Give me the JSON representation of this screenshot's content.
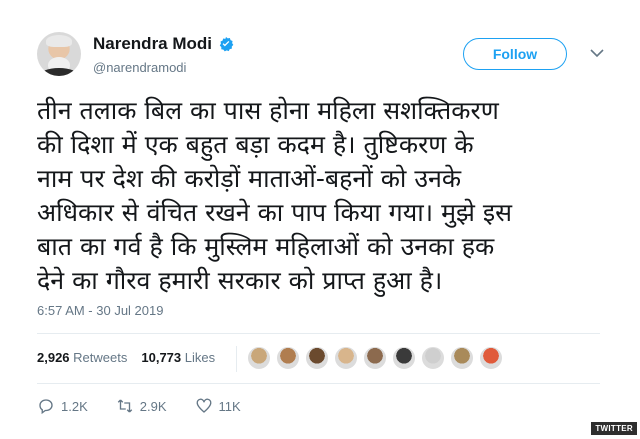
{
  "author": {
    "name": "Narendra Modi",
    "handle": "@narendramodi"
  },
  "follow_label": "Follow",
  "tweet_text": "तीन तलाक बिल का पास होना महिला सशक्तिकरण\nकी दिशा में एक बहुत बड़ा कदम है। तुष्टिकरण के\nनाम पर देश की करोड़ों माताओं-बहनों को उनके\nअधिकार से वंचित रखने का पाप किया गया। मुझे इस\nबात का गर्व है कि मुस्लिम महिलाओं को उनका हक\nदेने का गौरव हमारी सरकार को प्राप्त हुआ है।",
  "timestamp": "6:57 AM - 30 Jul 2019",
  "stats": {
    "retweets_count": "2,926",
    "retweets_label": "Retweets",
    "likes_count": "10,773",
    "likes_label": "Likes"
  },
  "liker_colors": [
    "#c9a77a",
    "#b07d4f",
    "#6b4a2e",
    "#d8b58c",
    "#8c6a4e",
    "#3a3a3a",
    "#cfcfcf",
    "#a98a5a",
    "#e05a3a"
  ],
  "actions": {
    "replies": "1.2K",
    "retweets": "2.9K",
    "likes": "11K"
  },
  "watermark": "TWITTER",
  "colors": {
    "accent": "#1da1f2",
    "muted": "#657786",
    "text": "#14171a"
  }
}
